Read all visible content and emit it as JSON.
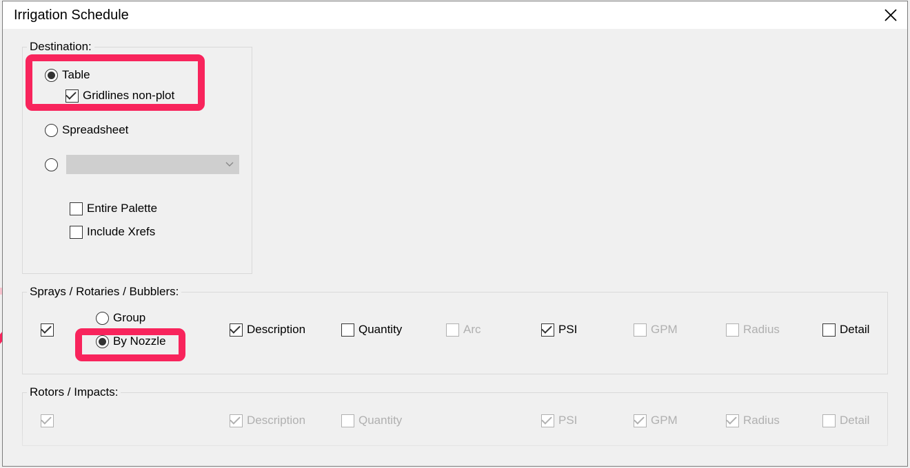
{
  "title": "Irrigation Schedule",
  "destination": {
    "label": "Destination:",
    "options": {
      "table": "Table",
      "gridlines": "Gridlines non-plot",
      "spreadsheet": "Spreadsheet",
      "entire_palette": "Entire Palette",
      "include_xrefs": "Include Xrefs"
    }
  },
  "sprays": {
    "label": "Sprays / Rotaries / Bubblers:",
    "group": "Group",
    "by_nozzle": "By Nozzle",
    "cols": {
      "description": "Description",
      "quantity": "Quantity",
      "arc": "Arc",
      "psi": "PSI",
      "gpm": "GPM",
      "radius": "Radius",
      "detail": "Detail"
    }
  },
  "rotors": {
    "label": "Rotors / Impacts:",
    "cols": {
      "description": "Description",
      "quantity": "Quantity",
      "psi": "PSI",
      "gpm": "GPM",
      "radius": "Radius",
      "detail": "Detail"
    }
  }
}
